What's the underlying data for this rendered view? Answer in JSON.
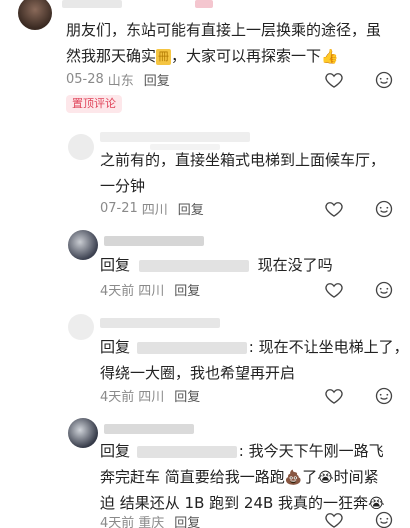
{
  "comments": [
    {
      "text_lines": [
        "朋友们，东站可能有直接上一层换乘的途径，虽",
        "然我那天确实",
        "，大家可以再探索一下"
      ],
      "inline_emoji": "🟨",
      "end_emoji": "👍",
      "date": "05-28",
      "location": "山东",
      "reply_label": "回复",
      "pinned_badge": "置顶评论"
    },
    {
      "text_lines": [
        "之前有的，直接坐箱式电梯到上面候车厅，",
        "一分钟"
      ],
      "date": "07-21",
      "location": "四川",
      "reply_label": "回复"
    },
    {
      "reply_prefix": "回复",
      "text_tail": "现在没了吗",
      "date": "4天前",
      "location": "四川",
      "reply_label": "回复"
    },
    {
      "reply_prefix": "回复",
      "text_lines": [
        ": 现在不让坐电梯上了，",
        "得绕一大圈，我也希望再开启"
      ],
      "date": "4天前",
      "location": "四川",
      "reply_label": "回复"
    },
    {
      "reply_prefix": "回复",
      "text_lines": [
        ": 我今天下午刚一路飞",
        "奔完赶车 简直要给我一路跑",
        "了",
        "时间紧",
        "迫 结果还从 1B 跑到 24B 我真的一狂奔"
      ],
      "emoji_poop": "💩",
      "emoji_cry": "😭",
      "date": "4天前",
      "location": "重庆",
      "reply_label": "回复"
    }
  ],
  "colors": {
    "accent": "#e0445a",
    "meta": "#8a8a8a",
    "text": "#222222"
  },
  "icons": [
    "heart-outline-icon",
    "comment-bubble-icon"
  ]
}
